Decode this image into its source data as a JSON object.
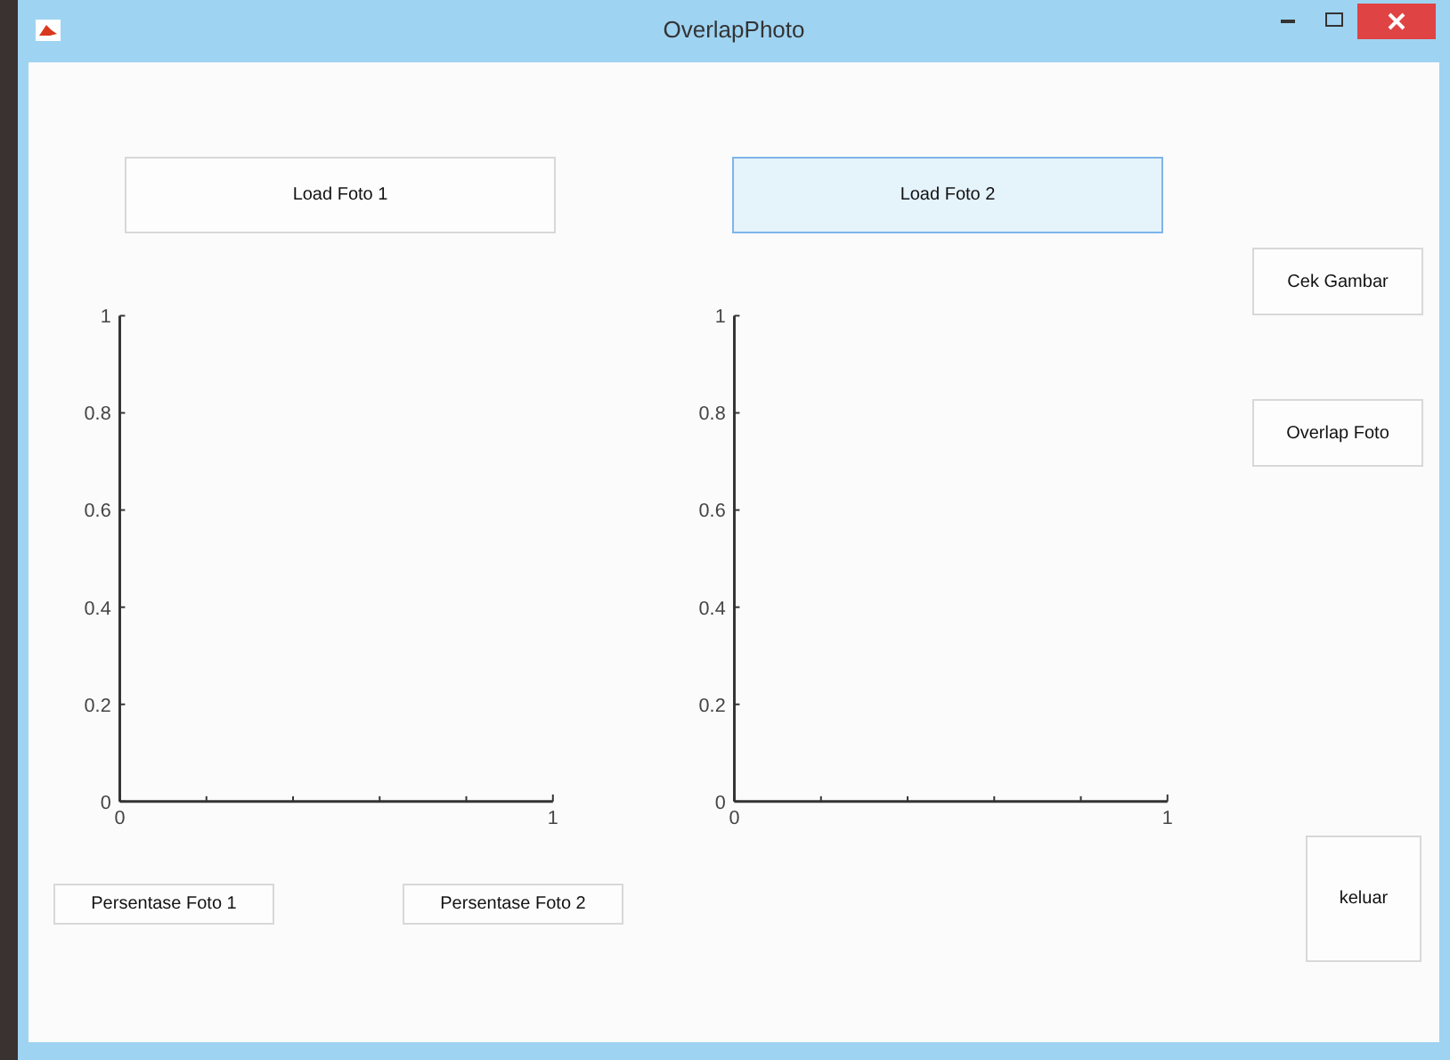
{
  "window": {
    "title": "OverlapPhoto"
  },
  "load_buttons": [
    {
      "label": "Load Foto 1",
      "selected": false
    },
    {
      "label": "Load Foto 2",
      "selected": true
    }
  ],
  "axes": [
    {
      "y_tick_labels": [
        "1",
        "0.8",
        "0.6",
        "0.4",
        "0.2",
        "0"
      ],
      "x_tick_labels": [
        "0",
        "1"
      ]
    },
    {
      "y_tick_labels": [
        "1",
        "0.8",
        "0.6",
        "0.4",
        "0.2",
        "0"
      ],
      "x_tick_labels": [
        "0",
        "1"
      ]
    }
  ],
  "percent_buttons": [
    "Persentase Foto 1",
    "Persentase Foto 2"
  ],
  "side_buttons": [
    "Cek Gambar",
    "Overlap Foto"
  ],
  "exit_button": "keluar"
}
